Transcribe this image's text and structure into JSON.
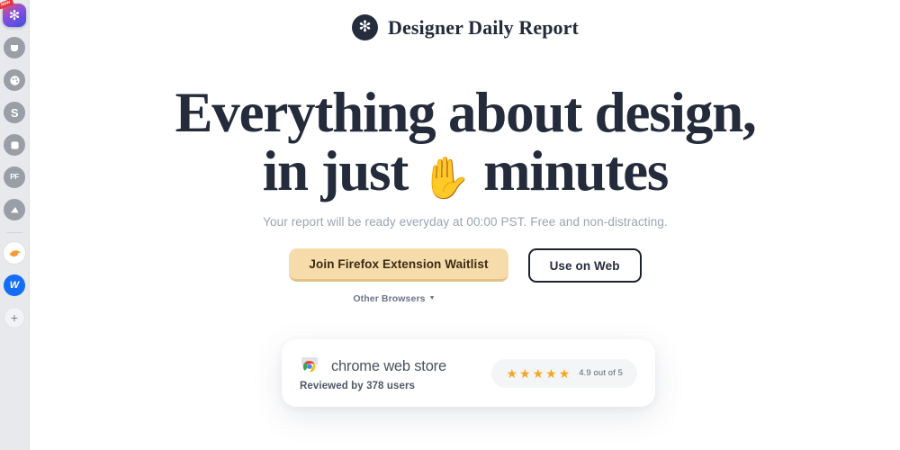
{
  "browser_sidebar": {
    "tabs": [
      {
        "name": "designer-daily-report-app",
        "glyph": "✻",
        "badge": "New",
        "style": "app"
      },
      {
        "name": "cup-icon",
        "glyph": "⛶",
        "style": "gray"
      },
      {
        "name": "palette-icon",
        "glyph": "◉",
        "style": "gray"
      },
      {
        "name": "s-icon",
        "glyph": "S",
        "style": "gray"
      },
      {
        "name": "square-icon",
        "glyph": "▢",
        "style": "gray"
      },
      {
        "name": "pf-icon",
        "glyph": "PF",
        "style": "gray"
      },
      {
        "name": "mountain-icon",
        "glyph": "◢",
        "style": "gray"
      }
    ],
    "pinned": [
      {
        "name": "orange-bird-icon",
        "glyph": "🐤",
        "style": "white"
      },
      {
        "name": "webflow-icon",
        "glyph": "W",
        "style": "blue"
      }
    ],
    "add_tab": {
      "name": "add-tab-button",
      "glyph": "+"
    }
  },
  "header": {
    "logo_glyph": "✻",
    "brand_name": "Designer Daily Report"
  },
  "hero": {
    "headline_line1": "Everything about design,",
    "headline_line2_before": "in just",
    "headline_emoji": "✋",
    "headline_line2_after": "minutes",
    "subheadline": "Your report will be ready everyday at 00:00 PST. Free and non-distracting.",
    "primary_cta": "Join Firefox Extension Waitlist",
    "secondary_cta": "Use on Web",
    "other_browsers": "Other Browsers",
    "other_browsers_caret": "▼"
  },
  "review_card": {
    "store_name": "chrome web store",
    "review_count": "Reviewed by 378 users",
    "stars": [
      "★",
      "★",
      "★",
      "★",
      "★"
    ],
    "rating_text": "4.9 out of 5"
  },
  "colors": {
    "sidebar_bg": "#e7e9ec",
    "page_bg": "#ffffff",
    "ink": "#242c3c",
    "muted": "#9ba3b4",
    "amber_button": "#f6dcaa",
    "star": "#f5a623",
    "webflow_blue": "#146ef5"
  }
}
